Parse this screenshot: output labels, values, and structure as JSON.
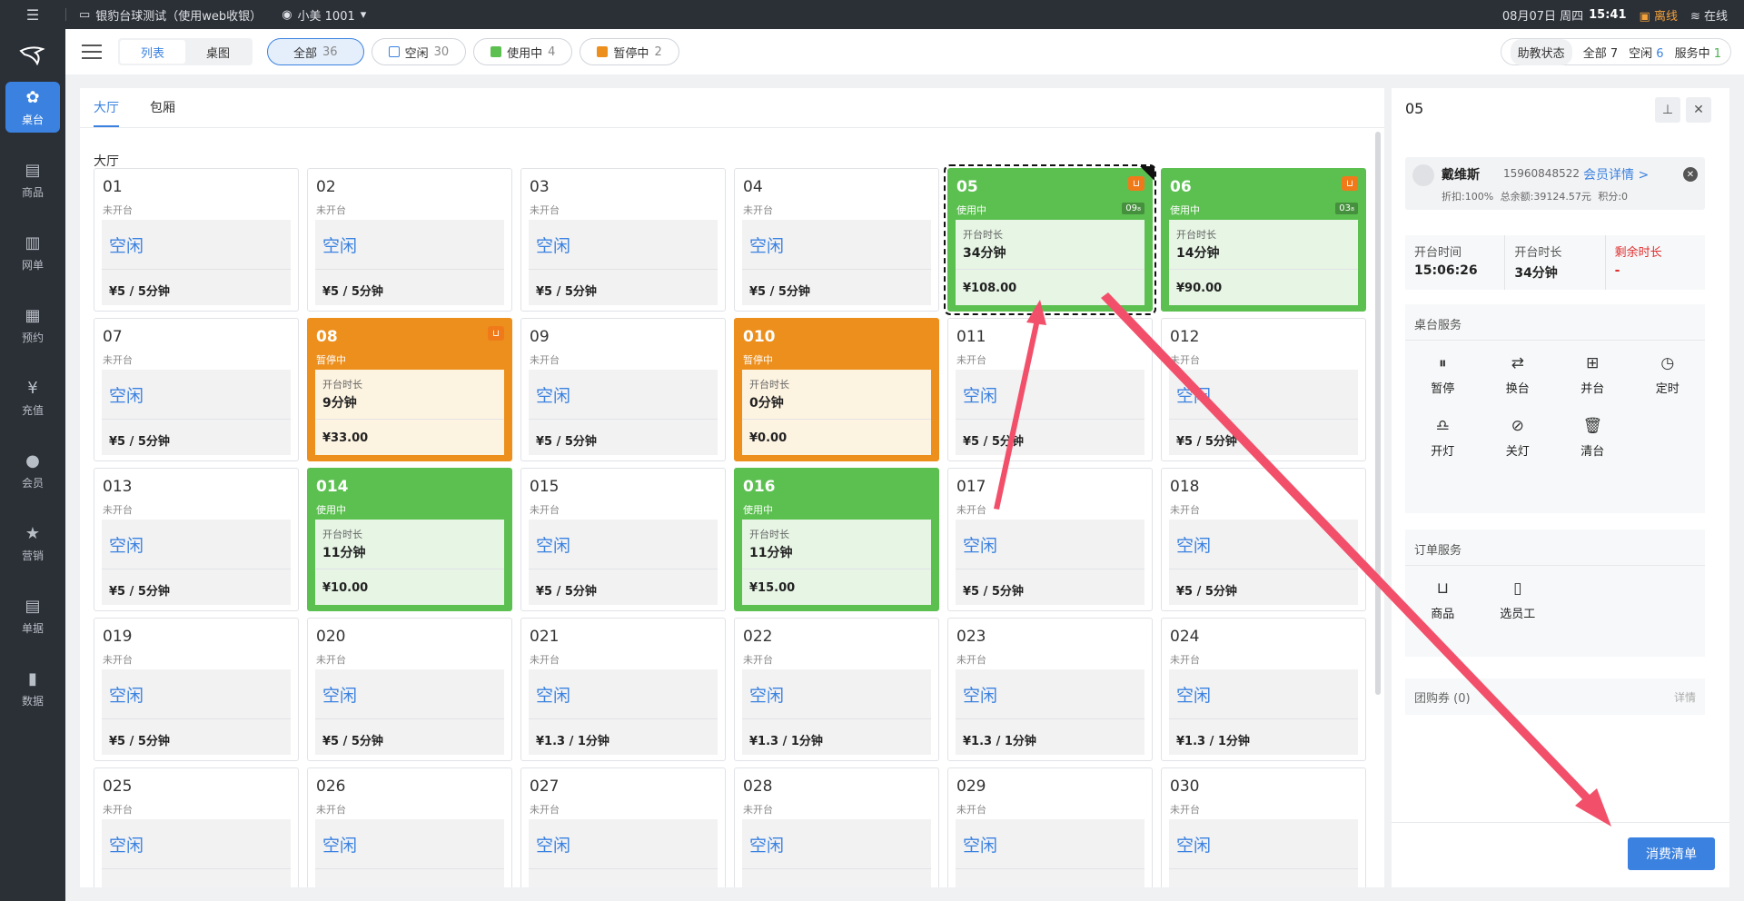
{
  "topbar": {
    "menu_icon": "menu-icon",
    "store": "银豹台球测试（使用web收银）",
    "user": "小美 1001",
    "date": "08月07日 周四",
    "time": "15:41",
    "offline": "离线",
    "online": "在线"
  },
  "sidebar": {
    "items": [
      {
        "label": "桌台",
        "icon": "table-icon"
      },
      {
        "label": "商品",
        "icon": "goods-icon"
      },
      {
        "label": "网单",
        "icon": "order-icon"
      },
      {
        "label": "预约",
        "icon": "calendar-icon"
      },
      {
        "label": "充值",
        "icon": "recharge-icon"
      },
      {
        "label": "会员",
        "icon": "member-icon"
      },
      {
        "label": "营销",
        "icon": "star-icon"
      },
      {
        "label": "单据",
        "icon": "document-icon"
      },
      {
        "label": "数据",
        "icon": "chart-icon"
      }
    ]
  },
  "header": {
    "view_list": "列表",
    "view_table": "桌图",
    "filters": [
      {
        "label": "全部",
        "count": "36"
      },
      {
        "label": "空闲",
        "count": "30"
      },
      {
        "label": "使用中",
        "count": "4"
      },
      {
        "label": "暂停中",
        "count": "2"
      }
    ],
    "assist": {
      "label": "助教状态",
      "all_label": "全部",
      "all_count": "7",
      "idle_label": "空闲",
      "idle_count": "6",
      "serving_label": "服务中",
      "serving_count": "1"
    }
  },
  "colors": {
    "accent": "#3b82e0",
    "in_use": "#5cc051",
    "paused": "#ec8f1d"
  },
  "main": {
    "tabs": [
      "大厅",
      "包厢"
    ],
    "section": "大厅",
    "tables": [
      {
        "num": "01",
        "status": "未开台",
        "state": "idle",
        "label": "空闲",
        "price": "¥5 / 5分钟"
      },
      {
        "num": "02",
        "status": "未开台",
        "state": "idle",
        "label": "空闲",
        "price": "¥5 / 5分钟"
      },
      {
        "num": "03",
        "status": "未开台",
        "state": "idle",
        "label": "空闲",
        "price": "¥5 / 5分钟"
      },
      {
        "num": "04",
        "status": "未开台",
        "state": "idle",
        "label": "空闲",
        "price": "¥5 / 5分钟"
      },
      {
        "num": "05",
        "status": "使用中",
        "state": "use",
        "dur_label": "开台时长",
        "dur": "34分钟",
        "amount": "¥108.00",
        "badge": "09",
        "cart": true,
        "selected": true
      },
      {
        "num": "06",
        "status": "使用中",
        "state": "use",
        "dur_label": "开台时长",
        "dur": "14分钟",
        "amount": "¥90.00",
        "badge": "03",
        "cart": true
      },
      {
        "num": "07",
        "status": "未开台",
        "state": "idle",
        "label": "空闲",
        "price": "¥5 / 5分钟"
      },
      {
        "num": "08",
        "status": "暂停中",
        "state": "pause",
        "dur_label": "开台时长",
        "dur": "9分钟",
        "amount": "¥33.00",
        "cart": true
      },
      {
        "num": "09",
        "status": "未开台",
        "state": "idle",
        "label": "空闲",
        "price": "¥5 / 5分钟"
      },
      {
        "num": "010",
        "status": "暂停中",
        "state": "pause",
        "dur_label": "开台时长",
        "dur": "0分钟",
        "amount": "¥0.00"
      },
      {
        "num": "011",
        "status": "未开台",
        "state": "idle",
        "label": "空闲",
        "price": "¥5 / 5分钟"
      },
      {
        "num": "012",
        "status": "未开台",
        "state": "idle",
        "label": "空闲",
        "price": "¥5 / 5分钟"
      },
      {
        "num": "013",
        "status": "未开台",
        "state": "idle",
        "label": "空闲",
        "price": "¥5 / 5分钟"
      },
      {
        "num": "014",
        "status": "使用中",
        "state": "use",
        "dur_label": "开台时长",
        "dur": "11分钟",
        "amount": "¥10.00"
      },
      {
        "num": "015",
        "status": "未开台",
        "state": "idle",
        "label": "空闲",
        "price": "¥5 / 5分钟"
      },
      {
        "num": "016",
        "status": "使用中",
        "state": "use",
        "dur_label": "开台时长",
        "dur": "11分钟",
        "amount": "¥15.00"
      },
      {
        "num": "017",
        "status": "未开台",
        "state": "idle",
        "label": "空闲",
        "price": "¥5 / 5分钟"
      },
      {
        "num": "018",
        "status": "未开台",
        "state": "idle",
        "label": "空闲",
        "price": "¥5 / 5分钟"
      },
      {
        "num": "019",
        "status": "未开台",
        "state": "idle",
        "label": "空闲",
        "price": "¥5 / 5分钟"
      },
      {
        "num": "020",
        "status": "未开台",
        "state": "idle",
        "label": "空闲",
        "price": "¥5 / 5分钟"
      },
      {
        "num": "021",
        "status": "未开台",
        "state": "idle",
        "label": "空闲",
        "price": "¥1.3 / 1分钟"
      },
      {
        "num": "022",
        "status": "未开台",
        "state": "idle",
        "label": "空闲",
        "price": "¥1.3 / 1分钟"
      },
      {
        "num": "023",
        "status": "未开台",
        "state": "idle",
        "label": "空闲",
        "price": "¥1.3 / 1分钟"
      },
      {
        "num": "024",
        "status": "未开台",
        "state": "idle",
        "label": "空闲",
        "price": "¥1.3 / 1分钟"
      },
      {
        "num": "025",
        "status": "未开台",
        "state": "idle",
        "label": "空闲",
        "price": ""
      },
      {
        "num": "026",
        "status": "未开台",
        "state": "idle",
        "label": "空闲",
        "price": ""
      },
      {
        "num": "027",
        "status": "未开台",
        "state": "idle",
        "label": "空闲",
        "price": ""
      },
      {
        "num": "028",
        "status": "未开台",
        "state": "idle",
        "label": "空闲",
        "price": ""
      },
      {
        "num": "029",
        "status": "未开台",
        "state": "idle",
        "label": "空闲",
        "price": ""
      },
      {
        "num": "030",
        "status": "未开台",
        "state": "idle",
        "label": "空闲",
        "price": ""
      }
    ]
  },
  "detail": {
    "title": "05",
    "member": {
      "name": "戴维斯",
      "phone": "15960848522",
      "detail_link": "会员详情 >",
      "stats": "折扣:100% 总余额:39124.57元 积分:0"
    },
    "open_time_label": "开台时间",
    "open_time": "15:06:26",
    "duration_label": "开台时长",
    "duration": "34分钟",
    "remaining_label": "剩余时长",
    "remaining": "-",
    "table_service_title": "桌台服务",
    "table_services": [
      {
        "label": "暂停",
        "icon": "pause-icon"
      },
      {
        "label": "换台",
        "icon": "switch-table-icon"
      },
      {
        "label": "并台",
        "icon": "merge-table-icon"
      },
      {
        "label": "定时",
        "icon": "timer-icon"
      },
      {
        "label": "开灯",
        "icon": "light-on-icon"
      },
      {
        "label": "关灯",
        "icon": "light-off-icon"
      },
      {
        "label": "清台",
        "icon": "clear-table-icon"
      }
    ],
    "order_service_title": "订单服务",
    "order_services": [
      {
        "label": "商品",
        "icon": "shopping-bag-icon"
      },
      {
        "label": "选员工",
        "icon": "staff-icon"
      }
    ],
    "coupon": "团购券 (0)",
    "coupon_detail": "详情",
    "bill_button": "消费清单"
  }
}
